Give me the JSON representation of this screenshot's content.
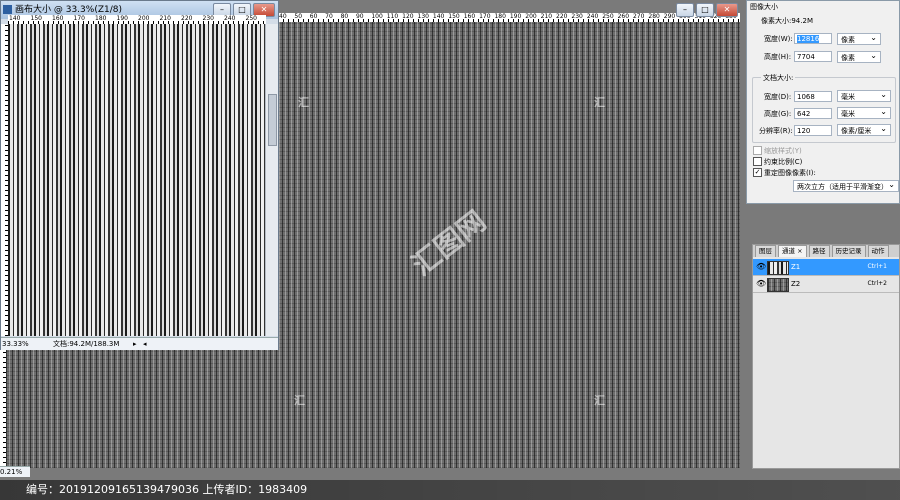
{
  "main_doc": {
    "status_percent": "0.21%"
  },
  "canvas_window": {
    "title": "画布大小 @ 33.3%(Z1/8)",
    "ruler_numbers": [
      "140",
      "150",
      "160",
      "170",
      "180",
      "190",
      "200",
      "210",
      "220",
      "230",
      "240",
      "250",
      "260"
    ],
    "zoom": "33.33%",
    "doc_size": "文档:94.2M/188.3M",
    "buttons": {
      "min": "–",
      "max": "□",
      "close": "✕"
    }
  },
  "main_window": {
    "ruler_numbers": [
      "40",
      "50",
      "60",
      "70",
      "80",
      "90",
      "100",
      "110",
      "120",
      "130",
      "140",
      "150",
      "160",
      "170",
      "180",
      "190",
      "200",
      "210",
      "220",
      "230",
      "240",
      "250",
      "260",
      "270",
      "280",
      "290",
      "300",
      "310",
      "320",
      "330",
      "340",
      "350"
    ],
    "buttons": {
      "min": "–",
      "max": "□",
      "close": "✕"
    }
  },
  "image_size": {
    "title": "图像大小",
    "pixel_size_label": "像素大小:94.2M",
    "width_label": "宽度(W):",
    "width_value": "12816",
    "width_unit": "像素",
    "height_label": "高度(H):",
    "height_value": "7704",
    "height_unit": "像素",
    "doc_size_label": "文档大小:",
    "doc_width_label": "宽度(D):",
    "doc_width_value": "1068",
    "doc_width_unit": "毫米",
    "doc_height_label": "高度(G):",
    "doc_height_value": "642",
    "doc_height_unit": "毫米",
    "resolution_label": "分辨率(R):",
    "resolution_value": "120",
    "resolution_unit": "像素/厘米",
    "scale_styles": "缩放样式(Y)",
    "constrain": "约束比例(C)",
    "resample": "重定图像像素(I):",
    "resample_method": "两次立方（适用于平滑渐变）",
    "constrain_checked": false,
    "resample_checked": true
  },
  "layers_panel": {
    "tabs": [
      "图层",
      "通道 ×",
      "路径",
      "历史记录",
      "动作"
    ],
    "active_tab": 1,
    "layers": [
      {
        "name": "Z1",
        "shortcut": "Ctrl+1",
        "selected": true
      },
      {
        "name": "Z2",
        "shortcut": "Ctrl+2",
        "selected": false
      }
    ]
  },
  "watermark": {
    "text": "汇图网",
    "small": "汇"
  },
  "footer": {
    "text": "编号：20191209165139479036 上传者ID：1983409"
  },
  "colors": {
    "selection": "#3399ff",
    "titlebar": "#b8cde6"
  }
}
